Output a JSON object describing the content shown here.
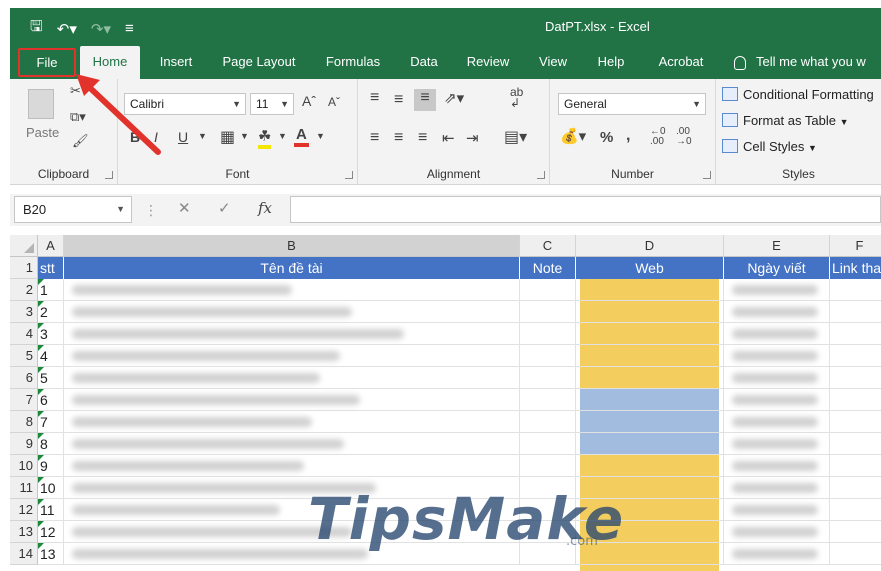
{
  "quick_access": {
    "save_icon": "save-icon",
    "undo_icon": "undo-icon",
    "redo_icon": "redo-icon",
    "customize_icon": "customize-qat-icon"
  },
  "window": {
    "title": "DatPT.xlsx  -  Excel"
  },
  "tabs": [
    "File",
    "Home",
    "Insert",
    "Page Layout",
    "Formulas",
    "Data",
    "Review",
    "View",
    "Help",
    "Acrobat"
  ],
  "active_tab": "Home",
  "tell_me": "Tell me what you w",
  "ribbon": {
    "clipboard": {
      "label": "Clipboard",
      "paste": "Paste"
    },
    "font": {
      "label": "Font",
      "name": "Calibri",
      "size": "11",
      "bold": "B",
      "italic": "I",
      "underline": "U",
      "grow": "Aˆ",
      "shrink": "Aˇ"
    },
    "alignment": {
      "label": "Alignment"
    },
    "number": {
      "label": "Number",
      "format": "General",
      "percent": "%",
      "comma": ","
    },
    "styles": {
      "label": "Styles",
      "conditional": "Conditional Formatting",
      "format_table": "Format as Table",
      "cell_styles": "Cell Styles"
    }
  },
  "formula_bar": {
    "name_box": "B20",
    "fx": "fx",
    "value": ""
  },
  "columns": [
    "A",
    "B",
    "C",
    "D",
    "E",
    "F"
  ],
  "header_row": {
    "a": "stt",
    "b": "Tên đề tài",
    "c": "Note",
    "d": "Web",
    "e": "Ngày viết",
    "f": "Link tha"
  },
  "rows": [
    {
      "num": "1",
      "stt": ""
    },
    {
      "num": "2",
      "stt": "1"
    },
    {
      "num": "3",
      "stt": "2"
    },
    {
      "num": "4",
      "stt": "3"
    },
    {
      "num": "5",
      "stt": "4"
    },
    {
      "num": "6",
      "stt": "5"
    },
    {
      "num": "7",
      "stt": "6"
    },
    {
      "num": "8",
      "stt": "7"
    },
    {
      "num": "9",
      "stt": "8"
    },
    {
      "num": "10",
      "stt": "9"
    },
    {
      "num": "11",
      "stt": "10"
    },
    {
      "num": "12",
      "stt": "11"
    },
    {
      "num": "13",
      "stt": "12"
    },
    {
      "num": "14",
      "stt": "13"
    }
  ],
  "watermark": {
    "text": "TipsMake",
    "suffix": ".com"
  },
  "colors": {
    "excel_green": "#217346",
    "header_blue": "#4472c4",
    "highlight": "#e2322c",
    "web_yellow": "#f2c94c",
    "web_blue": "#9db8dd"
  }
}
